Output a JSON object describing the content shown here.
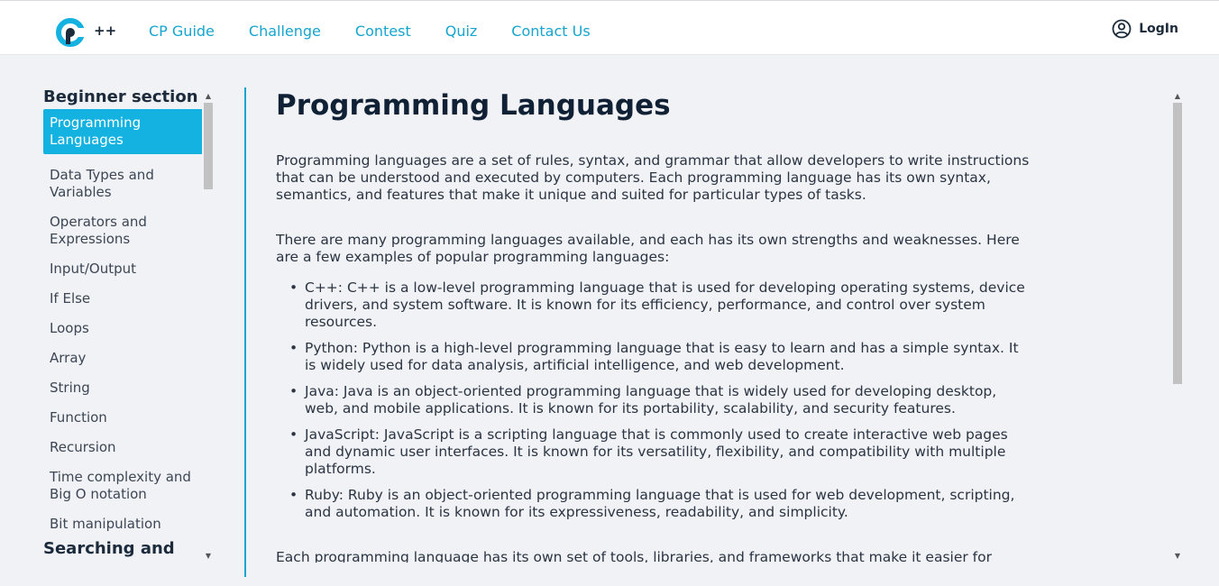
{
  "header": {
    "logo_plus": "++",
    "nav": [
      "CP Guide",
      "Challenge",
      "Contest",
      "Quiz",
      "Contact Us"
    ],
    "login_label": "LogIn"
  },
  "sidebar": {
    "sections": [
      {
        "title": "Beginner section",
        "items": [
          "Programming Languages",
          "Data Types and Variables",
          "Operators and Expressions",
          "Input/Output",
          "If Else",
          "Loops",
          "Array",
          "String",
          "Function",
          "Recursion",
          "Time complexity and Big O notation",
          "Bit manipulation"
        ],
        "active_index": 0
      },
      {
        "title": "Searching and Sorting",
        "items": []
      }
    ]
  },
  "main": {
    "title": "Programming Languages",
    "intro": "Programming languages are a set of rules, syntax, and grammar that allow developers to write instructions that can be understood and executed by computers. Each programming language has its own syntax, semantics, and features that make it unique and suited for particular types of tasks.",
    "examples_intro": "There are many programming languages available, and each has its own strengths and weaknesses. Here are a few examples of popular programming languages:",
    "languages": [
      "C++: C++ is a low-level programming language that is used for developing operating systems, device drivers, and system software. It is known for its efficiency, performance, and control over system resources.",
      "Python: Python is a high-level programming language that is easy to learn and has a simple syntax. It is widely used for data analysis, artificial intelligence, and web development.",
      "Java: Java is an object-oriented programming language that is widely used for developing desktop, web, and mobile applications. It is known for its portability, scalability, and security features.",
      "JavaScript: JavaScript is a scripting language that is commonly used to create interactive web pages and dynamic user interfaces. It is known for its versatility, flexibility, and compatibility with multiple platforms.",
      "Ruby: Ruby is an object-oriented programming language that is used for web development, scripting, and automation. It is known for its expressiveness, readability, and simplicity."
    ],
    "closing": "Each programming language has its own set of tools, libraries, and frameworks that make it easier for"
  },
  "colors": {
    "accent": "#16a5cf",
    "active_item_bg": "#13b2e0",
    "heading": "#102135",
    "background": "#f1f2f6"
  },
  "icons": {
    "logo": "cp-logo-icon",
    "login": "user-circle-icon",
    "scroll_up": "scroll-up-arrow-icon",
    "scroll_down": "scroll-down-arrow-icon"
  }
}
